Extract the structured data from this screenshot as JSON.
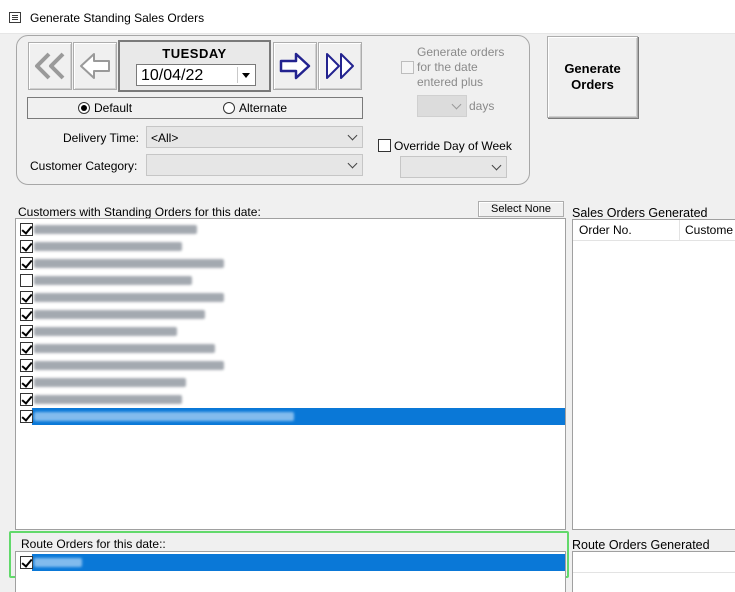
{
  "window": {
    "title": "Generate Standing Sales Orders",
    "icon": "window-icon"
  },
  "date_nav": {
    "day": "TUESDAY",
    "date": "10/04/22",
    "buttons": [
      "rewind-icon",
      "back-arrow-icon",
      "forward-arrow-icon",
      "fast-forward-icon"
    ]
  },
  "mode": {
    "default_label": "Default",
    "alternate_label": "Alternate",
    "selected": "Default"
  },
  "filters": {
    "delivery_time_label": "Delivery Time:",
    "delivery_time_value": "<All>",
    "customer_category_label": "Customer Category:",
    "customer_category_value": ""
  },
  "generate_options": {
    "line1": "Generate orders",
    "line2": "for the date",
    "line3": "entered plus",
    "days_label": "days",
    "days_value": "",
    "enabled": false,
    "checked": false
  },
  "override": {
    "label": "Override Day of Week",
    "checked": false,
    "value": ""
  },
  "generate_button": {
    "line1": "Generate",
    "line2": "Orders"
  },
  "customers": {
    "header": "Customers with Standing Orders for this date:",
    "select_none_label": "Select None",
    "rows": [
      {
        "checked": true,
        "selected": false,
        "width": 0.86
      },
      {
        "checked": true,
        "selected": false,
        "width": 0.78
      },
      {
        "checked": true,
        "selected": false,
        "width": 1.0
      },
      {
        "checked": false,
        "selected": false,
        "width": 0.83
      },
      {
        "checked": true,
        "selected": false,
        "width": 1.0
      },
      {
        "checked": true,
        "selected": false,
        "width": 0.9
      },
      {
        "checked": true,
        "selected": false,
        "width": 0.75
      },
      {
        "checked": true,
        "selected": false,
        "width": 0.95
      },
      {
        "checked": true,
        "selected": false,
        "width": 1.0
      },
      {
        "checked": true,
        "selected": false,
        "width": 0.8
      },
      {
        "checked": true,
        "selected": false,
        "width": 0.78
      },
      {
        "checked": true,
        "selected": true,
        "width": 1.0
      }
    ]
  },
  "sales_orders_generated": {
    "header": "Sales Orders Generated",
    "columns": [
      "Order No.",
      "Custome"
    ]
  },
  "route_orders": {
    "header": "Route Orders for this date::",
    "rows": [
      {
        "checked": true,
        "selected": true
      }
    ]
  },
  "route_orders_generated": {
    "header": "Route Orders Generated"
  },
  "colors": {
    "selection": "#0a78d7",
    "highlight_border": "#62d96b"
  }
}
